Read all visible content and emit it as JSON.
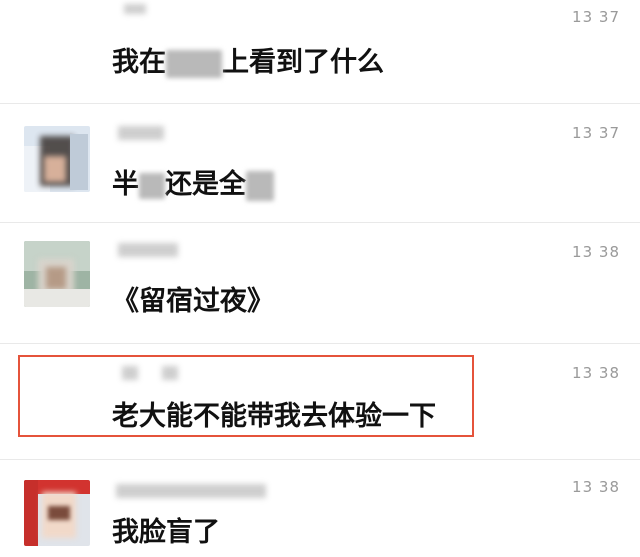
{
  "messages": [
    {
      "time": "13 37",
      "text_before": "我在",
      "text_after": "上看到了什么"
    },
    {
      "time": "13 37",
      "text_before": "半",
      "text_middle": "还是全"
    },
    {
      "time": "13 38",
      "text": "《留宿过夜》"
    },
    {
      "time": "13 38",
      "text": "老大能不能带我去体验一下",
      "highlighted": true
    },
    {
      "time": "13 38",
      "text": "我脸盲了"
    }
  ],
  "colors": {
    "highlight_border": "#e5533b",
    "time_text": "#9a9a9a",
    "message_text": "#111111"
  }
}
